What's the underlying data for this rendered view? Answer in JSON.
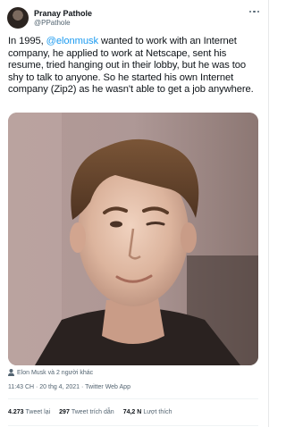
{
  "author": {
    "display_name": "Pranay Pathole",
    "handle": "@PPathole",
    "avatar_icon": "profile-photo"
  },
  "tweet": {
    "text_before": "In 1995, ",
    "mention": "@elonmusk",
    "text_after": " wanted to work with an Internet company, he applied to work at Netscape, sent his resume, tried hanging out in their lobby, but he was too shy to talk to anyone. So he started his own Internet company (Zip2) as he wasn't able to get a job anywhere."
  },
  "tagged_text": "Elon Musk và 2 người khác",
  "meta": "11:43 CH · 20 thg 4, 2021 · Twitter Web App",
  "stats": {
    "retweets_count": "4.273",
    "retweets_label": "Tweet lại",
    "quotes_count": "297",
    "quotes_label": "Tweet trích dẫn",
    "likes_count": "74,2 N",
    "likes_label": "Lượt thích"
  },
  "colors": {
    "accent": "#1d9bf0",
    "text_primary": "#0f1419",
    "text_secondary": "#536471",
    "divider": "#eff3f4"
  }
}
